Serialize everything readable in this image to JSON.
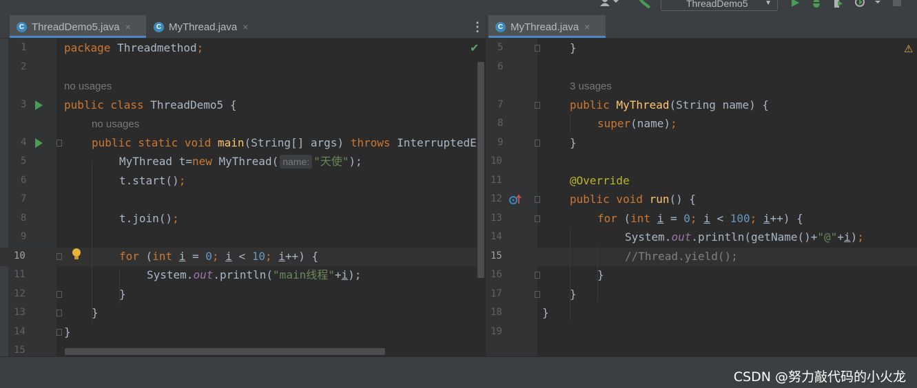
{
  "toolbar": {
    "run_config": "ThreadDemo5"
  },
  "left_editor": {
    "tabs": [
      {
        "label": "ThreadDemo5.java",
        "active": true
      },
      {
        "label": "MyThread.java",
        "active": false
      }
    ],
    "line_numbers": [
      "1",
      "2",
      "3",
      "4",
      "5",
      "6",
      "7",
      "8",
      "9",
      "10",
      "11",
      "12",
      "13",
      "14",
      "15"
    ],
    "current_line": "10",
    "usage_hints": [
      "no usages",
      "no usages"
    ],
    "code": {
      "l1_kw": "package",
      "l1_rest": " Threadmethod",
      "l1_semi": ";",
      "l3_kw": "public class",
      "l3_rest": " ThreadDemo5 {",
      "l4_kw": "public static void",
      "l4_fn": "main",
      "l4_rest1": "(String[] args) ",
      "l4_kw2": "throws",
      "l4_rest2": " InterruptedE",
      "l5_a": "MyThread t=",
      "l5_kw": "new",
      "l5_b": " MyThread(",
      "l5_hint": "name:",
      "l5_str": "\"天使\"",
      "l5_c": ");",
      "l6_a": "t.start()",
      "l6_semi": ";",
      "l8_a": "t.join()",
      "l8_semi": ";",
      "l10_kw": "for",
      "l10_a": " (",
      "l10_kw2": "int",
      "l10_i1": "i",
      "l10_b": " = ",
      "l10_n1": "0",
      "l10_s1": ";",
      "l10_i2": "i",
      "l10_c": " < ",
      "l10_n2": "10",
      "l10_s2": ";",
      "l10_i3": "i",
      "l10_d": "++) {",
      "l11_a": "System.",
      "l11_st": "out",
      "l11_b": ".println(",
      "l11_str": "\"main线程\"",
      "l11_c": "+",
      "l11_i": "i",
      "l11_d": ");",
      "l12": "}",
      "l13": "}",
      "l14": "}"
    }
  },
  "right_editor": {
    "tabs": [
      {
        "label": "MyThread.java",
        "active": true
      }
    ],
    "line_numbers": [
      "5",
      "6",
      "7",
      "8",
      "9",
      "10",
      "11",
      "12",
      "13",
      "14",
      "15",
      "16",
      "17",
      "18",
      "19"
    ],
    "current_line": "15",
    "usage_hints": [
      "3 usages"
    ],
    "code": {
      "l5": "}",
      "l7_kw": "public",
      "l7_fn": "MyThread",
      "l7_rest": "(String name) {",
      "l8_kw": "super",
      "l8_rest": "(name)",
      "l8_semi": ";",
      "l9": "}",
      "l11_ann": "@Override",
      "l12_kw": "public void",
      "l12_fn": "run",
      "l12_rest": "() {",
      "l13_kw": "for",
      "l13_a": " (",
      "l13_kw2": "int",
      "l13_i1": "i",
      "l13_b": " = ",
      "l13_n1": "0",
      "l13_s1": ";",
      "l13_i2": "i",
      "l13_c": " < ",
      "l13_n2": "100",
      "l13_s2": ";",
      "l13_i3": "i",
      "l13_d": "++) {",
      "l14_a": "System.",
      "l14_st": "out",
      "l14_b": ".println(getName()+",
      "l14_str": "\"@\"",
      "l14_c": "+",
      "l14_i": "i",
      "l14_d": ")",
      "l14_semi": ";",
      "l15_cmt": "//Thread.yield();",
      "l16": "}",
      "l17": "}",
      "l18": "}"
    }
  },
  "icons": {
    "file_icon_letter": "C",
    "close_glyph": "×",
    "warning_glyph": "⚠",
    "check_glyph": "✔",
    "more_glyph": "⋮",
    "bulb_glyph": "●"
  },
  "colors": {
    "run_green": "#499c54",
    "warning_yellow": "#e3b341",
    "accent_blue": "#4a88c7"
  },
  "watermark": "CSDN @努力敲代码的小火龙"
}
